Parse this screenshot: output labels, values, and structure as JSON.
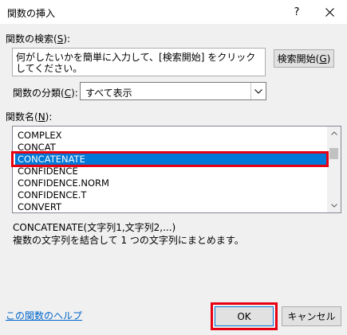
{
  "window": {
    "title": "関数の挿入",
    "help_symbol": "?",
    "close_symbol": "✕"
  },
  "search": {
    "label_prefix": "関数の検索(",
    "label_key": "S",
    "label_suffix": "):",
    "text": "何がしたいかを簡単に入力して、[検索開始] をクリックしてください。",
    "button_prefix": "検索開始(",
    "button_key": "G",
    "button_suffix": ")"
  },
  "category": {
    "label_prefix": "関数の分類(",
    "label_key": "C",
    "label_suffix": "):",
    "selected": "すべて表示"
  },
  "functions": {
    "label_prefix": "関数名(",
    "label_key": "N",
    "label_suffix": "):",
    "items": [
      "COMPLEX",
      "CONCAT",
      "CONCATENATE",
      "CONFIDENCE",
      "CONFIDENCE.NORM",
      "CONFIDENCE.T",
      "CONVERT"
    ],
    "selected_index": 2
  },
  "details": {
    "syntax": "CONCATENATE(文字列1,文字列2,...)",
    "description": "複数の文字列を結合して 1 つの文字列にまとめます。"
  },
  "footer": {
    "help_link": "この関数のヘルプ",
    "ok_label": "OK",
    "cancel_label": "キャンセル"
  },
  "colors": {
    "selection": "#0078d7",
    "highlight_frame": "#e60012",
    "link": "#0066cc"
  }
}
